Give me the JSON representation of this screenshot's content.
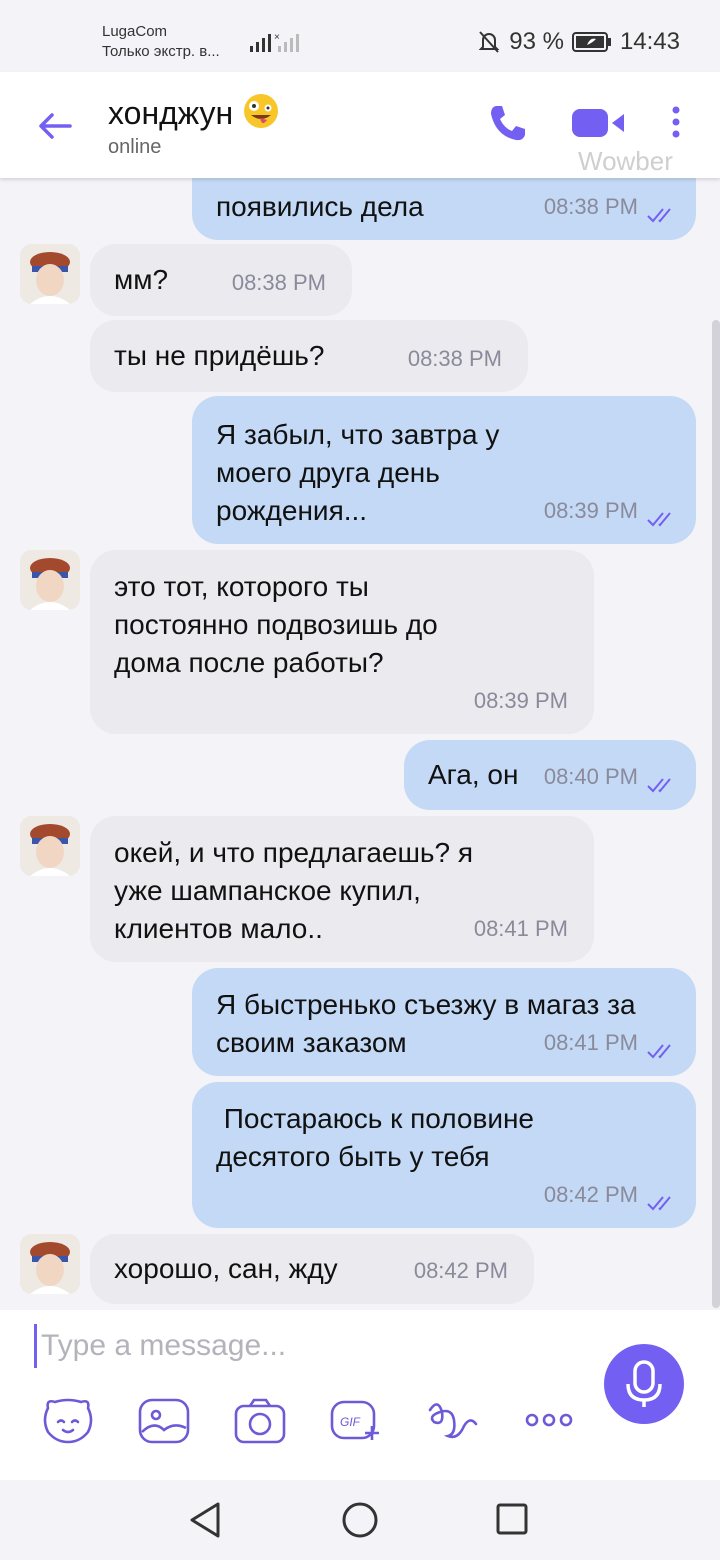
{
  "status_bar": {
    "carrier": "LugaCom",
    "carrier_sub": "Только экстр. в...",
    "battery": "93 %",
    "time": "14:43"
  },
  "header": {
    "contact_name": "хонджун",
    "status": "online",
    "watermark": "Wowber"
  },
  "messages": [
    {
      "dir": "out",
      "text": "появились дела",
      "time": "08:38 PM"
    },
    {
      "dir": "in",
      "text": "мм?",
      "time": "08:38 PM"
    },
    {
      "dir": "in",
      "text": "ты не придёшь?",
      "time": "08:38 PM"
    },
    {
      "dir": "out",
      "text": "Я забыл, что завтра у моего друга день рождения...",
      "time": "08:39 PM"
    },
    {
      "dir": "in",
      "text": "это тот, которого ты постоянно подвозишь до дома после работы?",
      "time": "08:39 PM"
    },
    {
      "dir": "out",
      "text": "Ага, он",
      "time": "08:40 PM"
    },
    {
      "dir": "in",
      "text": "окей, и что предлагаешь? я уже шампанское купил, клиентов мало..",
      "time": "08:41 PM"
    },
    {
      "dir": "out",
      "text": "Я быстренько съезжу в магаз за своим заказом",
      "time": "08:41 PM"
    },
    {
      "dir": "out",
      "text": " Постараюсь к половине десятого быть у тебя",
      "time": "08:42 PM"
    },
    {
      "dir": "in",
      "text": "хорошо, сан, жду",
      "time": "08:42 PM"
    }
  ],
  "composer": {
    "placeholder": "Type a message..."
  },
  "toolbar_icons": [
    "sticker-icon",
    "gallery-icon",
    "camera-icon",
    "gif-icon",
    "doodle-icon",
    "more-icon"
  ],
  "colors": {
    "accent": "#7360f2",
    "outgoing_bubble": "#c3d9f5",
    "incoming_bubble": "#ebeaef"
  }
}
